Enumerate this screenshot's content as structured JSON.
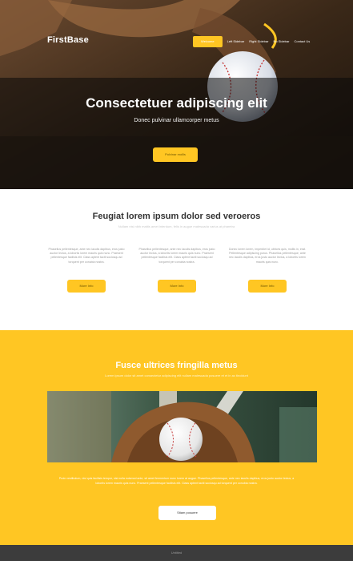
{
  "brand": {
    "name": "FirstBase"
  },
  "nav": {
    "items": [
      "Welcome",
      "Left Sidebar",
      "Right Sidebar",
      "No Sidebar",
      "Contact Us"
    ]
  },
  "hero": {
    "title": "Consectetuer adipiscing elit",
    "subtitle": "Donec pulvinar ullamcorper metus",
    "button": "Pulvinar mollis"
  },
  "features": {
    "title": "Feugiat lorem ipsum dolor sed veroeros",
    "subtitle": "Nullam nisi nibh mattis amet interdum, felis in augue malesuada varius at pharetra",
    "columns": [
      {
        "text": "Phasellus pellentesque, ante nec iaculis dapibus, eros justo auctor lectus, a lobortis lorem mauris quis nunc. Praesent pellentesque facilisis elit. Class aptent taciti sociosqu ad torquent per conubia nostra.",
        "button": "More Info"
      },
      {
        "text": "Phasellus pellentesque, ante nec iaculis dapibus, eros justo auctor lectus, a lobortis lorem mauris quis nunc. Praesent pellentesque facilisis elit. Class aptent taciti sociosqu ad torquent per conubia nostra.",
        "button": "More Info"
      },
      {
        "text": "Donec lorem lorem, imperdiet id, ultrices quis, mollis in, erat. Pellentesque adipiscing purus. Phasellus pellentesque, ante nec iaculis dapibus, eros justo auctor lectus, a lobortis lorem mauris quis nunc.",
        "button": "More Info"
      }
    ]
  },
  "featured": {
    "title": "Fusce ultrices fringilla metus",
    "subtitle": "Lorem ipsum dolor sit amet consectetur adipiscing elit nullam malesuada posuere et et in ac tincidunt",
    "body": "Proin vestibulum, nisi quis facilisis tempor, nisi nulla euismod ante, sit amet fermentum nunc lorem at augue. Phasellus pellentesque, ante nec iaculis dapibus, eros justo auctor lectus, a lobortis lorem mauris quis nunc. Praesent pellentesque facilisis elit. Class aptent taciti sociosqu ad torquent per conubia nostra.",
    "button": "Sitam posuere"
  },
  "footer": {
    "text": "Untitled"
  },
  "colors": {
    "accent": "#ffc623",
    "footer": "#3c3c3c",
    "heading": "#333333"
  },
  "icons": [
    "baseball-glove-image",
    "baseball-image"
  ]
}
